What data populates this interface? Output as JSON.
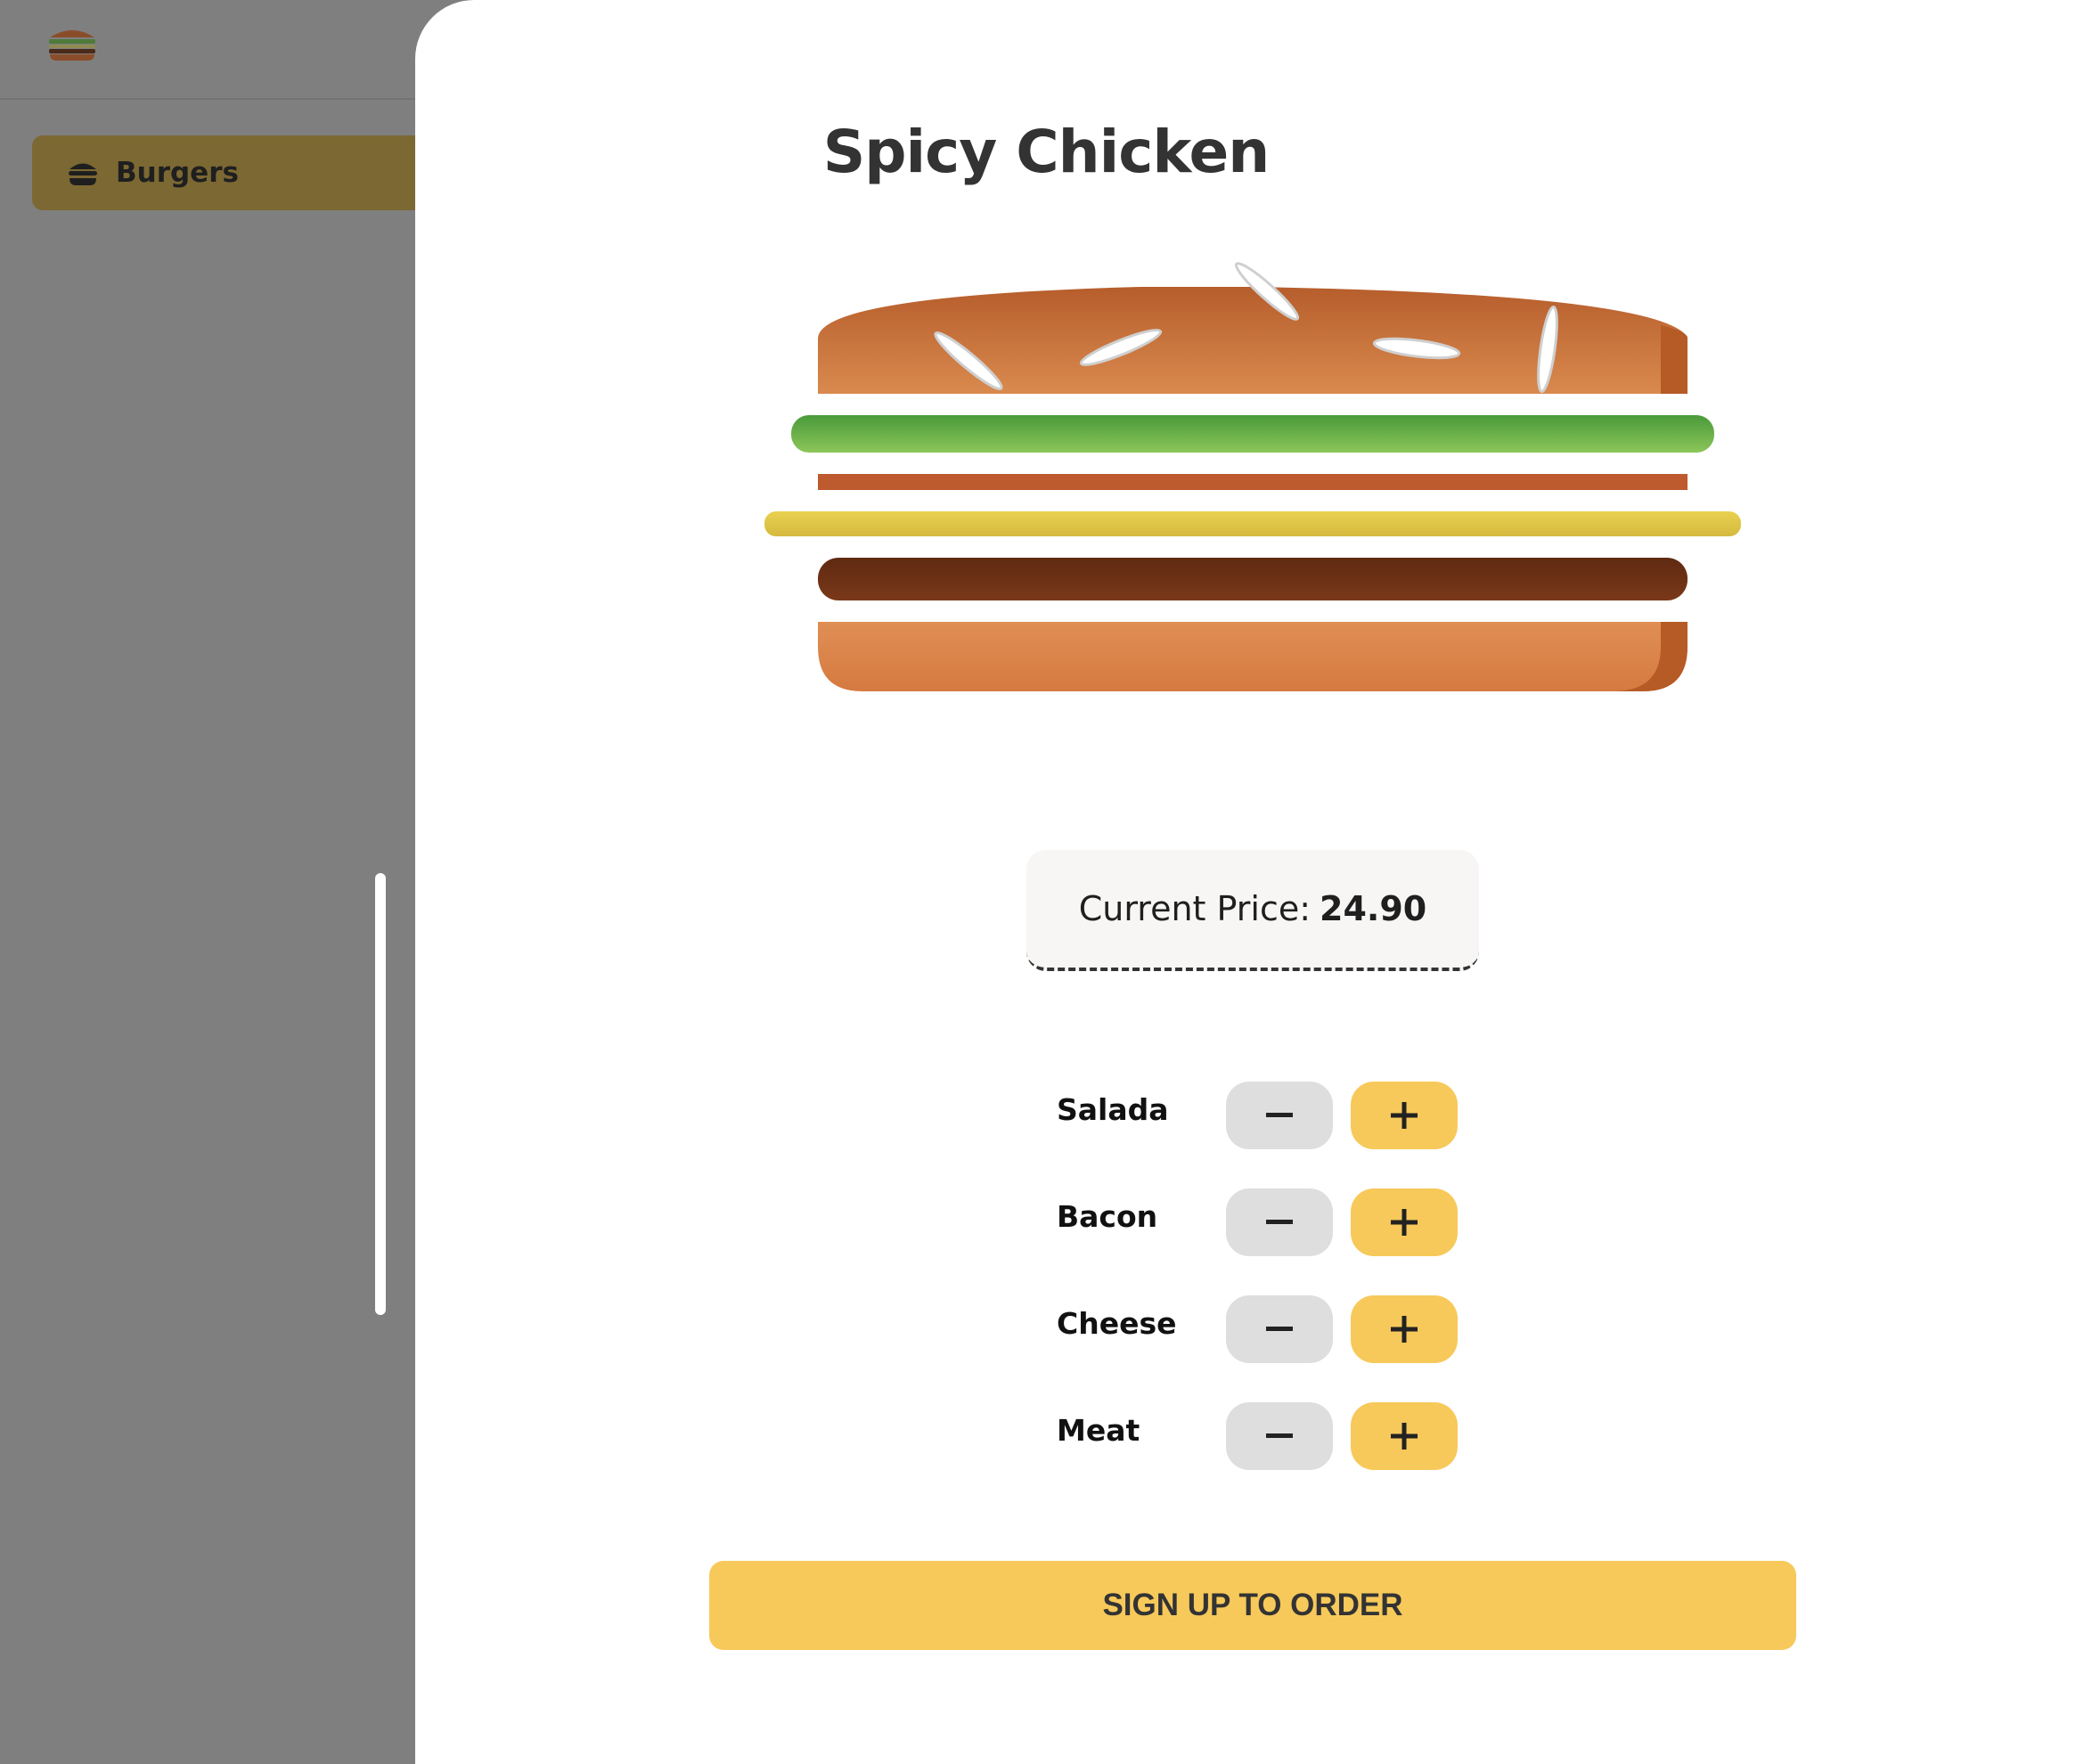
{
  "sidebar": {
    "logo_icon": "burger-logo-icon",
    "items": [
      {
        "label": "Burgers",
        "icon": "hamburger-icon",
        "active": true
      }
    ]
  },
  "modal": {
    "title": "Spicy Chicken",
    "price": {
      "label": "Current Price:",
      "value": "24.90"
    },
    "ingredients": [
      {
        "label": "Salada",
        "less_icon": "minus-icon",
        "more_icon": "plus-icon"
      },
      {
        "label": "Bacon",
        "less_icon": "minus-icon",
        "more_icon": "plus-icon"
      },
      {
        "label": "Cheese",
        "less_icon": "minus-icon",
        "more_icon": "plus-icon"
      },
      {
        "label": "Meat",
        "less_icon": "minus-icon",
        "more_icon": "plus-icon"
      }
    ],
    "order_button": "SIGN UP TO ORDER"
  },
  "colors": {
    "accent": "#f7c95a",
    "backdrop": "#7f7f7f",
    "less_button": "#dedede",
    "title": "#333333",
    "bun": "#d4824a",
    "salad": "#5aa83c",
    "bacon": "#b9532a",
    "cheese": "#e4c94a",
    "meat": "#6e3216"
  }
}
